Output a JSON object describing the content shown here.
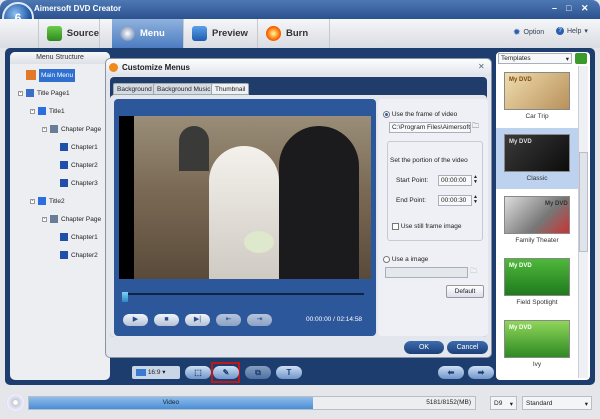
{
  "app": {
    "title": "Aimersoft DVD Creator"
  },
  "tabs": [
    {
      "label": "Source"
    },
    {
      "label": "Menu"
    },
    {
      "label": "Preview"
    },
    {
      "label": "Burn"
    }
  ],
  "top_links": {
    "option": "Option",
    "help": "Help"
  },
  "menu_structure": {
    "header": "Menu Structure",
    "items": [
      "Main Menu",
      "Title Page1",
      "Title1",
      "Chapter Page",
      "Chapter1",
      "Chapter2",
      "Chapter3",
      "Title2",
      "Chapter Page",
      "Chapter1",
      "Chapter2"
    ]
  },
  "dialog": {
    "title": "Customize Menus",
    "tabs": [
      "Background",
      "Background Music",
      "Thumbnail"
    ],
    "time_current": "00:00:00",
    "time_sep": "/",
    "time_total": "02:14:58",
    "use_frame_label": "Use the frame of video",
    "path_value": "C:\\Program Files\\Aimersoft\\",
    "portion_label": "Set the portion of the video",
    "start_label": "Start Point:",
    "start_value": "00:00:00",
    "end_label": "End Point:",
    "end_value": "00:00:30",
    "still_label": "Use still frame image",
    "use_image_label": "Use a image",
    "image_path": "",
    "default_label": "Default",
    "ok_label": "OK",
    "cancel_label": "Cancel"
  },
  "templates": {
    "dropdown": "Templates",
    "items": [
      {
        "name": "Car Trip",
        "thumb_text": "My DVD"
      },
      {
        "name": "Classic",
        "thumb_text": "My DVD"
      },
      {
        "name": "Family Theater",
        "thumb_text": "My DVD"
      },
      {
        "name": "Field Spotlight",
        "thumb_text": "My DVD"
      },
      {
        "name": "Ivy",
        "thumb_text": "My DVD"
      }
    ],
    "selected": "Classic"
  },
  "toolbar": {
    "aspect": "16:9"
  },
  "status": {
    "bar_label": "Video",
    "size": "5181/8152(MB)",
    "used_fraction": 0.636,
    "disc": "D9",
    "quality": "Standard"
  }
}
